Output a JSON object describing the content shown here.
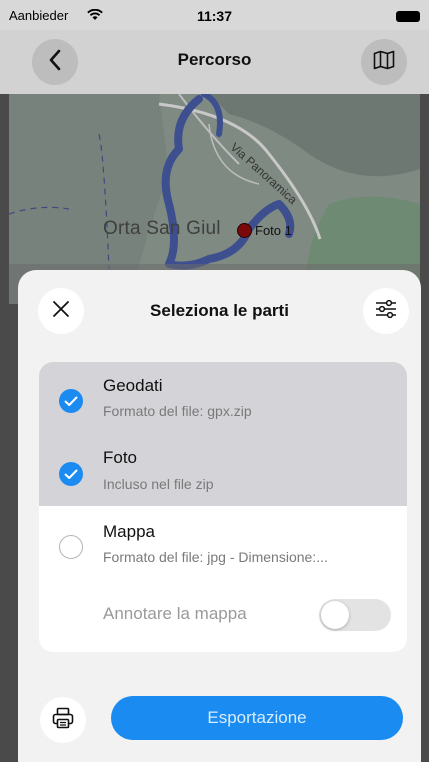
{
  "status_bar": {
    "carrier": "Aanbieder",
    "time": "11:37"
  },
  "nav": {
    "title": "Percorso",
    "back_icon": "chevron-left-icon",
    "map_icon": "map-icon"
  },
  "map": {
    "town_label": "Orta San Giul",
    "photo_label": "Foto 1",
    "road_label": "Via Panoramica",
    "track_color": "#3d4f8f",
    "photo_color": "#7a0a0a"
  },
  "sheet": {
    "title": "Seleziona le parti",
    "close_icon": "close-icon",
    "filter_icon": "sliders-icon",
    "items": [
      {
        "name": "Geodati",
        "sub": "Formato del file: gpx.zip",
        "checked": true
      },
      {
        "name": "Foto",
        "sub": "Incluso nel file zip",
        "checked": true
      },
      {
        "name": "Mappa",
        "sub": "Formato del file: jpg - Dimensione:...",
        "checked": false
      }
    ],
    "annotate_label": "Annotare la mappa",
    "annotate_on": false,
    "print_icon": "printer-icon",
    "export_label": "Esportazione",
    "accent_color": "#1a8bf0"
  }
}
